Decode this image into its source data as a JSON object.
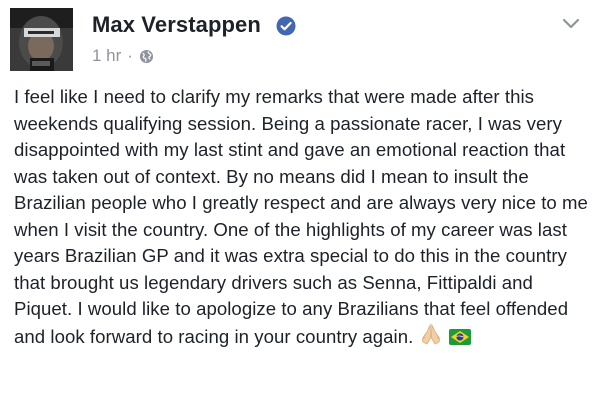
{
  "post": {
    "author": "Max Verstappen",
    "timestamp": "1 hr",
    "separator": "·",
    "privacy_icon": "globe-icon",
    "verified_icon": "verified-badge-icon",
    "menu_icon": "chevron-down-icon",
    "body": "I feel like I need to clarify my remarks that were made after this weekends qualifying session. Being a passionate racer, I was very disappointed with my last stint and gave an emotional reaction that was taken out of context. By no means did I mean to insult the Brazilian people who I greatly respect and are always very nice to me when I visit the country. One of the highlights of my career was last years Brazilian GP and it was extra special to do this in the country that brought us legendary drivers such as Senna, Fittipaldi and Piquet. I would like to apologize to any Brazilians that feel offended and look forward to racing in your country again.",
    "emojis": [
      "folded-hands-emoji",
      "brazil-flag-emoji"
    ]
  },
  "colors": {
    "text": "#1d2129",
    "meta": "#90949c",
    "verified": "#4267b2"
  }
}
